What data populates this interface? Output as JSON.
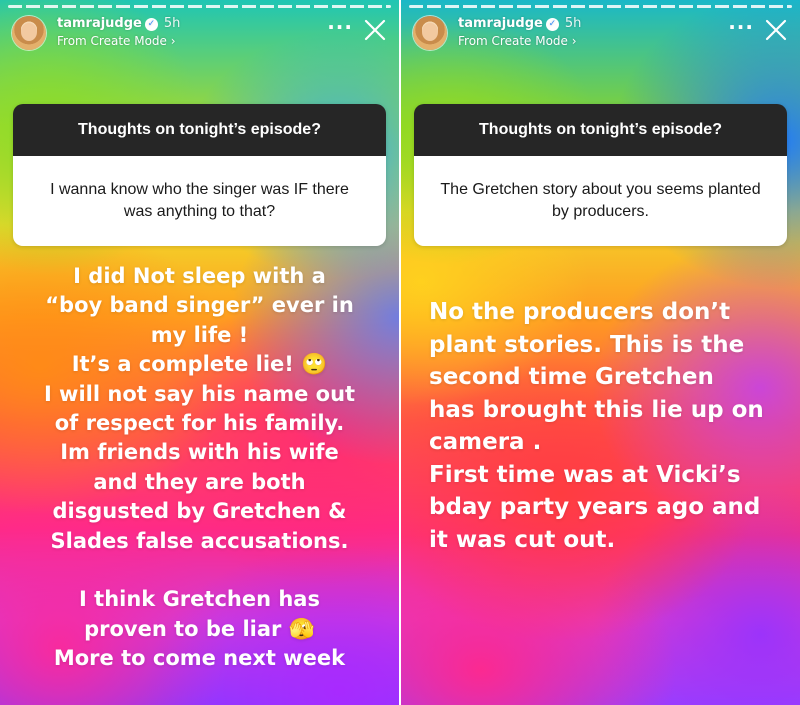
{
  "stories": [
    {
      "header": {
        "username": "tamrajudge",
        "time": "5h",
        "subline": "From Create Mode ›",
        "verified_icon": "verified-badge-icon",
        "more_icon": "more-icon",
        "close_icon": "close-icon"
      },
      "question": "Thoughts on tonight’s episode?",
      "answer": "I wanna know who the singer was IF there was anything to that?",
      "reply": "I did Not sleep with a\n“boy band singer” ever in\nmy life !\nIt’s a complete lie! 🙄\nI will not say his name out\nof respect for his family.\nIm friends with his wife\nand they are both\ndisgusted by Gretchen &\nSlades false accusations.\n\nI think Gretchen has\nproven to be liar 🫣\nMore to come next week"
    },
    {
      "header": {
        "username": "tamrajudge",
        "time": "5h",
        "subline": "From Create Mode ›",
        "verified_icon": "verified-badge-icon",
        "more_icon": "more-icon",
        "close_icon": "close-icon"
      },
      "question": "Thoughts on tonight’s episode?",
      "answer": "The Gretchen story about you seems planted by producers.",
      "reply": "No the producers don’t\nplant stories.  This is the\nsecond time Gretchen\nhas brought this lie up on\ncamera .\nFirst time was at Vicki’s\nbday party years ago and\nit was cut out."
    }
  ],
  "colors": {
    "card_header_bg": "#262626",
    "card_body_bg": "#ffffff",
    "verified_blue": "#3a8ffb"
  }
}
